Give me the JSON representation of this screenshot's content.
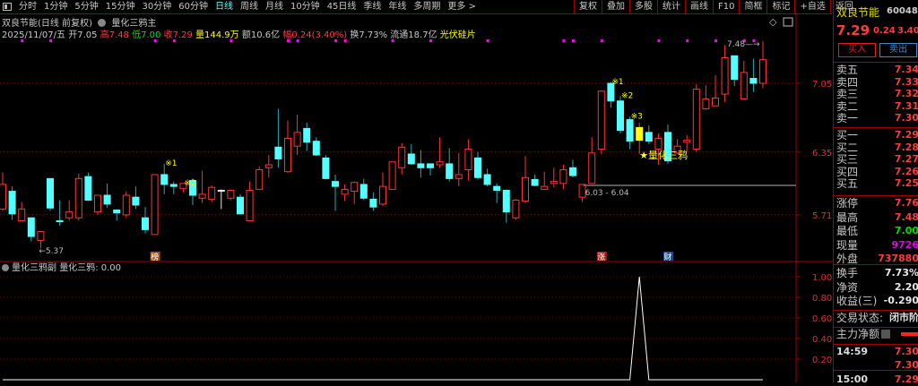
{
  "toolbar": {
    "tabs": [
      "分时",
      "1分钟",
      "5分钟",
      "15分钟",
      "30分钟",
      "60分钟",
      "日线",
      "周线",
      "月线",
      "10分钟",
      "45日线",
      "季线",
      "年线",
      "多周期",
      "更多 >"
    ],
    "active_tab": "日线",
    "buttons": [
      "复权",
      "叠加",
      "多股",
      "统计",
      "画线",
      "F10",
      "简框",
      "标记",
      "+自选",
      "返回"
    ]
  },
  "header": {
    "title": "双良节能(日线 前复权)",
    "indicator": "量化三鸦主",
    "date": "2025/11/07/五",
    "open_label": "开",
    "open": "7.05",
    "high_label": "高",
    "high": "7.48",
    "low_label": "低",
    "low": "7.00",
    "close_label": "收",
    "close": "7.29",
    "vol_label": "量",
    "volume": "144.9万",
    "amount_label": "额",
    "amount": "10.6亿",
    "change_label": "幅",
    "change": "0.24(3.40%)",
    "turnover_label": "换",
    "turnover": "7.73%",
    "float_label": "流通",
    "float_cap": "18.7亿",
    "sector": "光伏硅片"
  },
  "panel": {
    "name": "双良节能",
    "code": "600481",
    "price": "7.29",
    "change": "0.24",
    "pct": "3.40%",
    "buy": "买入",
    "sell": "卖出",
    "asks": [
      {
        "label": "卖五",
        "price": "7.34"
      },
      {
        "label": "卖四",
        "price": "7.33"
      },
      {
        "label": "卖三",
        "price": "7.32"
      },
      {
        "label": "卖二",
        "price": "7.31"
      },
      {
        "label": "卖一",
        "price": "7.30"
      }
    ],
    "bids": [
      {
        "label": "买一",
        "price": "7.29"
      },
      {
        "label": "买二",
        "price": "7.28"
      },
      {
        "label": "买三",
        "price": "7.27"
      },
      {
        "label": "买四",
        "price": "7.26"
      },
      {
        "label": "买五",
        "price": "7.25"
      }
    ],
    "stats": [
      {
        "label": "涨停",
        "value": "7.76",
        "color": "#ff3c3c"
      },
      {
        "label": "最高",
        "value": "7.48",
        "color": "#ff3c3c"
      },
      {
        "label": "最低",
        "value": "7.00",
        "color": "#00e000"
      },
      {
        "label": "现量",
        "value": "9726",
        "color": "#e000e0"
      },
      {
        "label": "外盘",
        "value": "737880",
        "color": "#ff3c3c"
      }
    ],
    "stats2": [
      {
        "label": "换手",
        "value": "7.73%"
      },
      {
        "label": "净资",
        "value": "2.20"
      },
      {
        "label": "收益(三)",
        "value": "-0.290"
      }
    ],
    "status_label": "交易状态:",
    "status": "闭市阶",
    "main_flow_label": "主力净额",
    "ticks": [
      {
        "time": "14:59",
        "price": "7.30"
      },
      {
        "time": "",
        "price": "7.30"
      },
      {
        "time": "15:00",
        "price": "7.29"
      }
    ]
  },
  "colors": {
    "up": "#ff3232",
    "down": "#54ffff",
    "signal": "#ffff00",
    "grid": "#a00000",
    "marker": "#ff00ff"
  },
  "chart_data": {
    "type": "candlestick",
    "fields": [
      "open",
      "high",
      "low",
      "close"
    ],
    "price_axis_ticks": [
      "7.05",
      "6.35",
      "5.71"
    ],
    "candles": [
      [
        5.77,
        6.14,
        5.75,
        6.02
      ],
      [
        5.95,
        6.0,
        5.66,
        5.72
      ],
      [
        5.65,
        5.84,
        5.65,
        5.77
      ],
      [
        5.68,
        5.68,
        5.44,
        5.49
      ],
      [
        5.45,
        5.54,
        5.37,
        5.54
      ],
      [
        6.08,
        6.08,
        5.75,
        5.78
      ],
      [
        5.65,
        5.86,
        5.6,
        5.64
      ],
      [
        5.68,
        5.86,
        5.65,
        5.74
      ],
      [
        5.68,
        6.13,
        5.65,
        6.08
      ],
      [
        6.1,
        6.14,
        5.85,
        5.86
      ],
      [
        5.74,
        5.91,
        5.71,
        5.91
      ],
      [
        5.91,
        6.03,
        5.78,
        5.82
      ],
      [
        5.76,
        5.76,
        5.65,
        5.73
      ],
      [
        5.71,
        5.95,
        5.68,
        5.91
      ],
      [
        5.89,
        6.0,
        5.77,
        5.81
      ],
      [
        5.68,
        5.79,
        5.52,
        5.56
      ],
      [
        5.51,
        6.12,
        5.51,
        6.12
      ],
      [
        6.12,
        6.23,
        5.92,
        6.02
      ],
      [
        6.02,
        6.05,
        5.92,
        6.0
      ],
      [
        5.98,
        6.03,
        5.94,
        6.03
      ],
      [
        6.06,
        6.08,
        5.81,
        5.91
      ],
      [
        5.88,
        6.16,
        5.83,
        5.92
      ],
      [
        5.87,
        6.01,
        5.84,
        5.99
      ],
      [
        5.96,
        5.97,
        5.77,
        5.96
      ],
      [
        5.88,
        5.96,
        5.86,
        5.96
      ],
      [
        5.89,
        5.92,
        5.72,
        5.72
      ],
      [
        5.65,
        6.05,
        5.65,
        5.96
      ],
      [
        5.97,
        6.2,
        5.97,
        6.17
      ],
      [
        6.19,
        6.32,
        6.09,
        6.22
      ],
      [
        6.4,
        6.79,
        6.19,
        6.28
      ],
      [
        6.15,
        6.67,
        6.14,
        6.49
      ],
      [
        6.41,
        6.73,
        6.32,
        6.55
      ],
      [
        6.59,
        6.65,
        6.36,
        6.45
      ],
      [
        6.46,
        6.5,
        6.31,
        6.32
      ],
      [
        6.29,
        6.32,
        6.07,
        6.08
      ],
      [
        6.05,
        6.12,
        5.75,
        6.0
      ],
      [
        5.92,
        6.02,
        5.85,
        5.97
      ],
      [
        5.95,
        6.05,
        5.82,
        6.04
      ],
      [
        6.02,
        6.08,
        5.86,
        5.88
      ],
      [
        5.87,
        5.94,
        5.75,
        5.79
      ],
      [
        5.82,
        6.14,
        5.8,
        6.0
      ],
      [
        5.97,
        6.25,
        5.97,
        6.25
      ],
      [
        6.19,
        6.44,
        6.12,
        6.4
      ],
      [
        6.33,
        6.43,
        6.22,
        6.23
      ],
      [
        6.23,
        6.37,
        6.09,
        6.19
      ],
      [
        6.23,
        6.23,
        6.11,
        6.19
      ],
      [
        6.22,
        6.5,
        6.19,
        6.25
      ],
      [
        6.23,
        6.39,
        6.05,
        6.08
      ],
      [
        6.08,
        6.34,
        6.0,
        6.12
      ],
      [
        6.17,
        6.48,
        6.06,
        6.38
      ],
      [
        6.29,
        6.35,
        6.07,
        6.09
      ],
      [
        6.12,
        6.18,
        6.0,
        6.02
      ],
      [
        6.0,
        6.03,
        5.83,
        5.96
      ],
      [
        5.96,
        5.97,
        5.63,
        5.74
      ],
      [
        5.68,
        5.87,
        5.66,
        5.86
      ],
      [
        5.85,
        6.31,
        5.83,
        6.09
      ],
      [
        6.07,
        6.12,
        6.0,
        6.01
      ],
      [
        5.97,
        6.15,
        5.97,
        6.0
      ],
      [
        6.03,
        6.19,
        5.99,
        6.05
      ],
      [
        6.03,
        6.22,
        5.97,
        6.17
      ],
      [
        6.19,
        6.27,
        6.09,
        6.11
      ],
      [
        5.89,
        6.02,
        5.84,
        6.02
      ],
      [
        6.03,
        6.5,
        6.03,
        6.34
      ],
      [
        6.38,
        6.97,
        6.33,
        6.97
      ],
      [
        7.05,
        7.06,
        6.8,
        6.87
      ],
      [
        6.87,
        6.92,
        6.54,
        6.57
      ],
      [
        6.68,
        6.71,
        6.38,
        6.46
      ],
      [
        6.6,
        6.65,
        6.33,
        6.47
      ],
      [
        6.55,
        6.62,
        6.43,
        6.46
      ],
      [
        6.38,
        6.54,
        6.22,
        6.49
      ],
      [
        6.55,
        6.63,
        6.23,
        6.26
      ],
      [
        6.34,
        6.48,
        6.33,
        6.41
      ],
      [
        6.45,
        6.52,
        6.35,
        6.47
      ],
      [
        6.38,
        7.04,
        6.35,
        6.99
      ],
      [
        6.79,
        7.03,
        6.78,
        6.89
      ],
      [
        6.82,
        7.13,
        6.82,
        6.9
      ],
      [
        6.94,
        7.44,
        6.86,
        7.31
      ],
      [
        7.33,
        7.33,
        7.02,
        7.09
      ],
      [
        6.89,
        7.28,
        6.89,
        7.16
      ],
      [
        7.1,
        7.3,
        6.96,
        7.05
      ],
      [
        7.05,
        7.48,
        7.0,
        7.29
      ]
    ],
    "signal_candle": 67,
    "cross_candle": 23,
    "annotations": [
      {
        "candle": 17,
        "text": "※1"
      },
      {
        "candle": 19,
        "text": "※2"
      },
      {
        "candle": 64,
        "text": "※1"
      },
      {
        "candle": 65,
        "text": "※2"
      },
      {
        "candle": 66,
        "text": "※3"
      },
      {
        "candle": 67,
        "text": "★量化三鸦"
      }
    ],
    "low_label": {
      "candle": 4,
      "text": "5.37"
    },
    "high_label": {
      "candle": 80,
      "text": "7.48"
    },
    "range_line": {
      "from_candle": 61,
      "text": "6.03 - 6.04"
    },
    "badges": [
      {
        "candle": 16,
        "text": "榜",
        "color": "#a0501e"
      },
      {
        "candle": 63,
        "text": "涨",
        "color": "#a02020"
      },
      {
        "candle": 70,
        "text": "财",
        "color": "#204a8a"
      }
    ],
    "event_dots": [
      2,
      5,
      16,
      18,
      24,
      30,
      31,
      35,
      36,
      41,
      45,
      51,
      59,
      60,
      63,
      69,
      72,
      75,
      78,
      79
    ],
    "sub": {
      "title": "量化三鸦副",
      "series_name": "量化三鸦",
      "value": "0.00",
      "ticks": [
        "1.00",
        "0.80",
        "0.60",
        "0.40",
        "0.20"
      ],
      "ylim": [
        0,
        1
      ],
      "spike_candle": 67
    }
  }
}
